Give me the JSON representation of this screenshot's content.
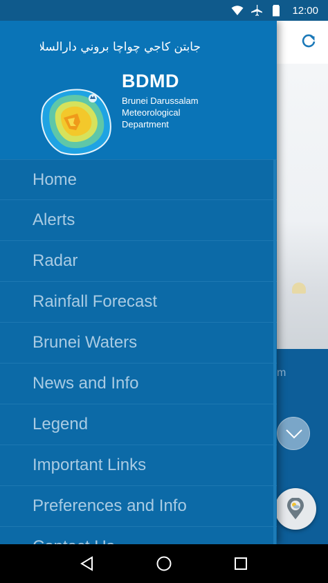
{
  "status_bar": {
    "time": "12:00",
    "icons": [
      "wifi-icon",
      "airplane-icon",
      "battery-icon"
    ]
  },
  "drawer": {
    "header": {
      "jawi_text": "جابتن كاجي چواچا بروني دارالسلام",
      "title": "BDMD",
      "subtitle_lines": [
        "Brunei Darussalam",
        "Meteorological",
        "Department"
      ]
    },
    "menu_items": [
      {
        "label": "Home"
      },
      {
        "label": "Alerts"
      },
      {
        "label": "Radar"
      },
      {
        "label": "Rainfall Forecast"
      },
      {
        "label": "Brunei Waters"
      },
      {
        "label": "News and Info"
      },
      {
        "label": "Legend"
      },
      {
        "label": "Important Links"
      },
      {
        "label": "Preferences and Info"
      },
      {
        "label": "Contact Us"
      }
    ]
  },
  "background_app": {
    "unit_fragment": "m"
  },
  "colors": {
    "drawer_bg": "#0c6aa7",
    "header_bg": "#0a74b7",
    "menu_text": "#a9cbe3",
    "status_bar": "#0f5a8c"
  },
  "nav_bar": {
    "buttons": [
      "back-icon",
      "home-icon",
      "recents-icon"
    ]
  }
}
